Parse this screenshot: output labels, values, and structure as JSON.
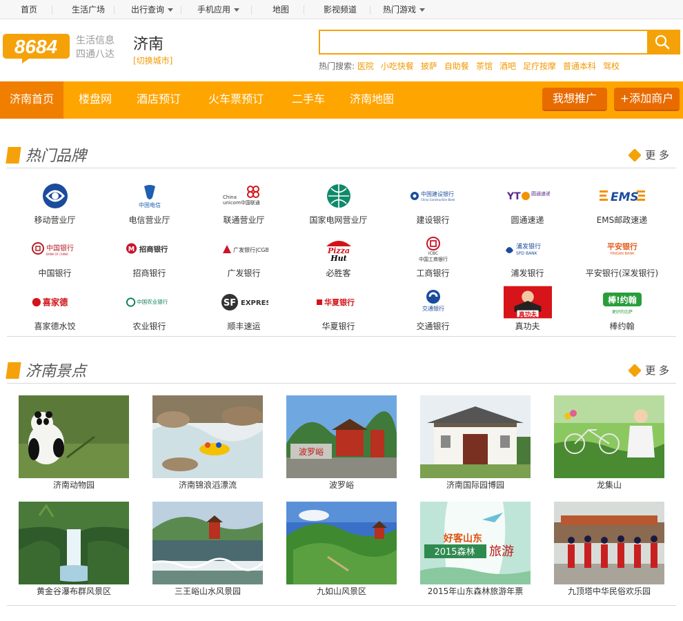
{
  "topnav": {
    "items": [
      {
        "label": "首页"
      },
      {
        "label": "生活广场"
      },
      {
        "label": "出行查询"
      },
      {
        "label": "手机应用"
      },
      {
        "label": "地图"
      },
      {
        "label": "影视频道"
      },
      {
        "label": "热门游戏"
      }
    ]
  },
  "header": {
    "logo_text": "8684",
    "slogan_line1": "生活信息",
    "slogan_line2": "四通八达",
    "city": "济南",
    "switch_city": "[切换城市]",
    "search_placeholder": "",
    "hot_label": "热门搜索:",
    "hot_keywords": [
      "医院",
      "小吃快餐",
      "披萨",
      "自助餐",
      "茶馆",
      "酒吧",
      "足疗按摩",
      "普通本科",
      "驾校"
    ]
  },
  "nav": {
    "items": [
      "济南首页",
      "楼盘网",
      "酒店预订",
      "火车票预订",
      "二手车",
      "济南地图"
    ],
    "promote": "我想推广",
    "add_merchant": "+添加商户"
  },
  "brands": {
    "title": "热门品牌",
    "more": "更 多",
    "items": [
      {
        "name": "移动营业厅",
        "logo": "CM"
      },
      {
        "name": "电信营业厅",
        "logo": "中国电信"
      },
      {
        "name": "联通营业厅",
        "logo": "China unicom中国联通"
      },
      {
        "name": "国家电网营业厅",
        "logo": "SGCC"
      },
      {
        "name": "建设银行",
        "logo": "中国建设银行"
      },
      {
        "name": "圆通速递",
        "logo": "YTO 圆通速递"
      },
      {
        "name": "EMS邮政速递",
        "logo": "EMS"
      },
      {
        "name": "中国银行",
        "logo": "中国银行"
      },
      {
        "name": "招商银行",
        "logo": "招商银行"
      },
      {
        "name": "广发银行",
        "logo": "广发银行|CGB"
      },
      {
        "name": "必胜客",
        "logo": "Pizza Hut"
      },
      {
        "name": "工商银行",
        "logo": "ICBC 中国工商银行"
      },
      {
        "name": "浦发银行",
        "logo": "浦发银行 SPD BANK"
      },
      {
        "name": "平安银行(深发银行)",
        "logo": "平安银行 PINGAN BANK"
      },
      {
        "name": "喜家德水饺",
        "logo": "喜家德"
      },
      {
        "name": "农业银行",
        "logo": "中国农业银行"
      },
      {
        "name": "顺丰速运",
        "logo": "SF EXPRESS"
      },
      {
        "name": "华夏银行",
        "logo": "华夏银行"
      },
      {
        "name": "交通银行",
        "logo": "交通银行"
      },
      {
        "name": "真功夫",
        "logo": "真功夫"
      },
      {
        "name": "棒约翰",
        "logo": "棒约翰"
      }
    ]
  },
  "spots": {
    "title": "济南景点",
    "more": "更 多",
    "items": [
      {
        "name": "济南动物园"
      },
      {
        "name": "济南锦浪滔漂流"
      },
      {
        "name": "波罗峪"
      },
      {
        "name": "济南国际园博园"
      },
      {
        "name": "龙集山"
      },
      {
        "name": "黄金谷瀑布群风景区"
      },
      {
        "name": "三王峪山水风景园"
      },
      {
        "name": "九如山风景区"
      },
      {
        "name": "2015年山东森林旅游年票"
      },
      {
        "name": "九顶塔中华民俗欢乐园"
      }
    ]
  },
  "colors": {
    "accent": "#ffa500",
    "accent_dark": "#f07f00",
    "link": "#f39800"
  }
}
